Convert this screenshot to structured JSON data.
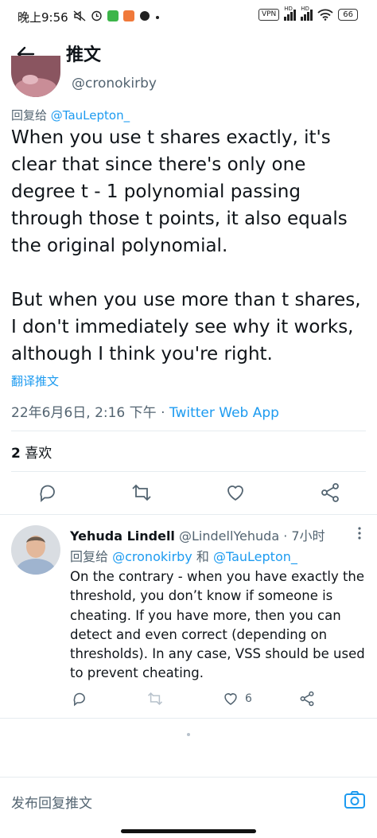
{
  "status_bar": {
    "time": "晚上9:56",
    "vpn": "VPN",
    "signal_1": "HD",
    "signal_2": "HD",
    "battery": "66",
    "colors": {
      "app_green": "#3cb54a",
      "app_orange": "#f0793a"
    }
  },
  "header": {
    "back_icon": "arrow-left-icon",
    "title": "推文"
  },
  "tweet": {
    "handle": "@cronokirby",
    "reply_prefix": "回复给",
    "reply_to": "@TauLepton_",
    "body": "When you use t shares exactly, it's clear that since there's only one degree t - 1 polynomial passing through those t points, it also equals the original polynomial.\n\nBut when you use more than t shares, I don't immediately see why it works, although I think you're right.",
    "translate": "翻译推文",
    "datetime": "22年6月6日, 2:16 下午",
    "separator": "·",
    "client": "Twitter Web App",
    "likes_count": "2",
    "likes_label": "喜欢",
    "actions": [
      "reply-icon",
      "retweet-icon",
      "like-icon",
      "share-icon"
    ]
  },
  "reply": {
    "author_name": "Yehuda Lindell",
    "author_handle": "@LindellYehuda",
    "age": "· 7小时",
    "reply_prefix": "回复给",
    "reply_user_1": "@cronokirby",
    "reply_and": "和",
    "reply_user_2": "@TauLepton_",
    "text": "On the contrary - when you have exactly the threshold, you don’t know if someone is cheating. If you have more, then you can detect and even correct (depending on thresholds). In any case, VSS should be used to prevent cheating.",
    "like_count": "6"
  },
  "compose": {
    "placeholder": "发布回复推文",
    "camera_icon": "camera-icon"
  },
  "colors": {
    "accent": "#1d9bf0",
    "secondary_text": "#536471",
    "divider": "#e6ecf0"
  }
}
